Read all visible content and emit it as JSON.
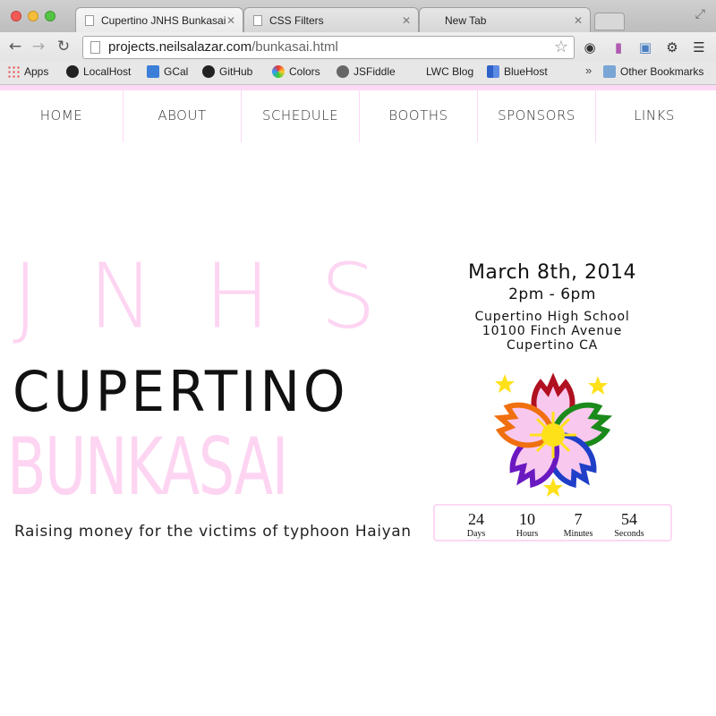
{
  "browser": {
    "tabs": [
      {
        "title": "Cupertino JNHS Bunkasai"
      },
      {
        "title": "CSS Filters"
      },
      {
        "title": "New Tab"
      }
    ],
    "url_domain": "projects.neilsalazar.com",
    "url_path": "/bunkasai.html",
    "bookmarks": [
      "Apps",
      "LocalHost",
      "GCal",
      "GitHub",
      "Colors",
      "JSFiddle",
      "LWC Blog",
      "BlueHost"
    ],
    "overflow": "»",
    "other_bookmarks": "Other Bookmarks",
    "gcal_day": "17"
  },
  "site": {
    "nav": [
      "HOME",
      "ABOUT",
      "SCHEDULE",
      "BOOTHS",
      "SPONSORS",
      "LINKS"
    ],
    "hero": {
      "line1": "JNHS",
      "line2": "CUPERTINO",
      "line3": "BUNKASAI",
      "tagline": "Raising money for the victims of typhoon Haiyan"
    },
    "event": {
      "date": "March 8th, 2014",
      "time": "2pm - 6pm",
      "address": [
        "Cupertino High School",
        "10100 Finch Avenue",
        "Cupertino CA"
      ]
    },
    "countdown": [
      {
        "value": "24",
        "label": "Days"
      },
      {
        "value": "10",
        "label": "Hours"
      },
      {
        "value": "7",
        "label": "Minutes"
      },
      {
        "value": "54",
        "label": "Seconds"
      }
    ]
  },
  "colors": {
    "accent_pink": "#fcd9f4",
    "text_dark": "#111111"
  }
}
